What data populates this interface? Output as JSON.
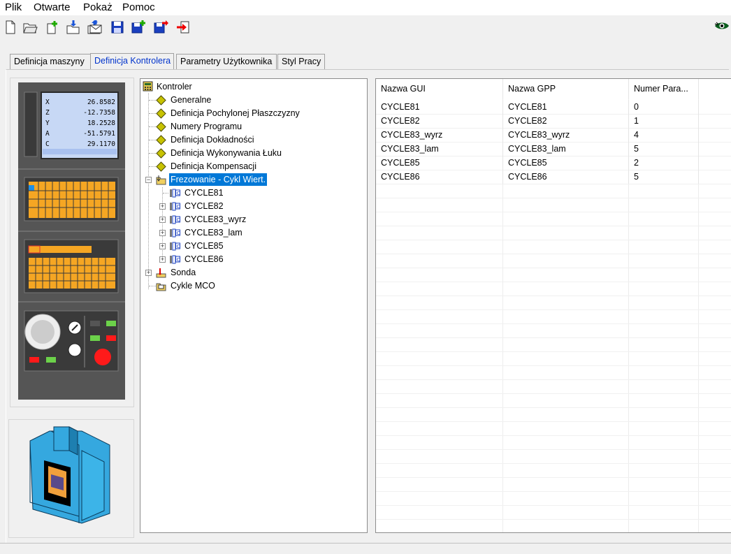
{
  "menu": [
    "Plik",
    "Otwarte",
    "Pokaż",
    "Pomoc"
  ],
  "toolbar": [
    "new-file-icon",
    "open-folder-icon",
    "add-file-icon",
    "import-folder-icon",
    "export-folder-icon",
    "envelope-icon",
    "save-icon",
    "save-add-icon",
    "save-as-icon",
    "exit-icon"
  ],
  "tabs": [
    {
      "label": "Definicja maszyny",
      "active": false
    },
    {
      "label": "Definicja Kontrolera",
      "active": true
    },
    {
      "label": "Parametry Użytkownika",
      "active": false
    },
    {
      "label": "Styl Pracy",
      "active": false
    }
  ],
  "controller_display": [
    {
      "axis": "X",
      "value": "26.8582"
    },
    {
      "axis": "Z",
      "value": "-12.7358"
    },
    {
      "axis": "Y",
      "value": "18.2528"
    },
    {
      "axis": "A",
      "value": "-51.5791"
    },
    {
      "axis": "C",
      "value": "29.1170"
    }
  ],
  "tree": {
    "root": "Kontroler",
    "items": [
      {
        "label": "Generalne",
        "icon": "diamond-icon"
      },
      {
        "label": "Definicja Pochylonej Płaszczyzny",
        "icon": "diamond-icon"
      },
      {
        "label": "Numery Programu",
        "icon": "diamond-icon"
      },
      {
        "label": "Definicja Dokładności",
        "icon": "diamond-icon"
      },
      {
        "label": "Definicja Wykonywania Łuku",
        "icon": "diamond-icon"
      },
      {
        "label": "Definicja Kompensacji",
        "icon": "diamond-icon"
      },
      {
        "label": "Frezowanie - Cykl Wiert.",
        "icon": "folder-cycle-icon",
        "selected": true
      },
      {
        "label": "CYCLE81",
        "icon": "cycle-icon"
      },
      {
        "label": "CYCLE82",
        "icon": "cycle-icon"
      },
      {
        "label": "CYCLE83_wyrz",
        "icon": "cycle-icon"
      },
      {
        "label": "CYCLE83_lam",
        "icon": "cycle-icon"
      },
      {
        "label": "CYCLE85",
        "icon": "cycle-icon"
      },
      {
        "label": "CYCLE86",
        "icon": "cycle-icon"
      },
      {
        "label": "Sonda",
        "icon": "probe-icon"
      },
      {
        "label": "Cykle MCO",
        "icon": "folder-cycle-icon"
      }
    ]
  },
  "grid": {
    "columns": [
      "Nazwa GUI",
      "Nazwa GPP",
      "Numer Para..."
    ],
    "rows": [
      [
        "CYCLE81",
        "CYCLE81",
        "0"
      ],
      [
        "CYCLE82",
        "CYCLE82",
        "1"
      ],
      [
        "CYCLE83_wyrz",
        "CYCLE83_wyrz",
        "4"
      ],
      [
        "CYCLE83_lam",
        "CYCLE83_lam",
        "5"
      ],
      [
        "CYCLE85",
        "CYCLE85",
        "2"
      ],
      [
        "CYCLE86",
        "CYCLE86",
        "5"
      ]
    ]
  }
}
